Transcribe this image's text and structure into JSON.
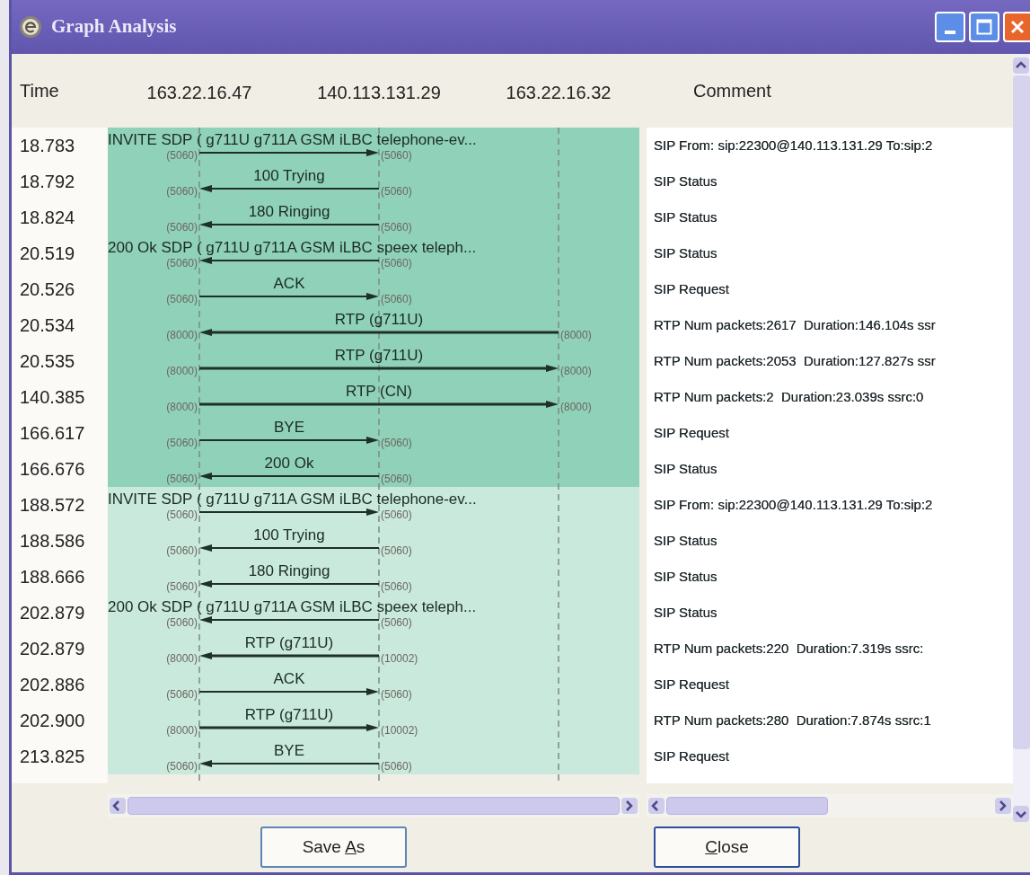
{
  "window": {
    "title": "Graph Analysis"
  },
  "header": {
    "time": "Time",
    "nodes": [
      "163.22.16.47",
      "140.113.131.29",
      "163.22.16.32"
    ],
    "comment": "Comment"
  },
  "calls": [
    {
      "color": "#8fd1b9",
      "rows": [
        {
          "time": "18.783",
          "label": "INVITE SDP ( g711U g711A GSM iLBC telephone-ev...",
          "port_a": "(5060)",
          "port_b": "(5060)",
          "leftward": false,
          "kind": "sip",
          "comment": "SIP From: sip:22300@140.113.131.29 To:sip:2"
        },
        {
          "time": "18.792",
          "label": "100 Trying",
          "port_a": "(5060)",
          "port_b": "(5060)",
          "leftward": true,
          "kind": "sip",
          "comment": "SIP Status"
        },
        {
          "time": "18.824",
          "label": "180 Ringing",
          "port_a": "(5060)",
          "port_b": "(5060)",
          "leftward": true,
          "kind": "sip",
          "comment": "SIP Status"
        },
        {
          "time": "20.519",
          "label": "200 Ok SDP ( g711U g711A GSM iLBC speex teleph...",
          "port_a": "(5060)",
          "port_b": "(5060)",
          "leftward": true,
          "kind": "sip",
          "comment": "SIP Status"
        },
        {
          "time": "20.526",
          "label": "ACK",
          "port_a": "(5060)",
          "port_b": "(5060)",
          "leftward": false,
          "kind": "sip",
          "comment": "SIP Request"
        },
        {
          "time": "20.534",
          "label": "RTP (g711U)",
          "port_a": "(8000)",
          "port_c": "(8000)",
          "leftward": true,
          "kind": "rtp",
          "comment": "RTP Num packets:2617  Duration:146.104s ssr"
        },
        {
          "time": "20.535",
          "label": "RTP (g711U)",
          "port_a": "(8000)",
          "port_c": "(8000)",
          "leftward": false,
          "kind": "rtp",
          "comment": "RTP Num packets:2053  Duration:127.827s ssr"
        },
        {
          "time": "140.385",
          "label": "RTP (CN)",
          "port_a": "(8000)",
          "port_c": "(8000)",
          "leftward": false,
          "kind": "rtp",
          "comment": "RTP Num packets:2  Duration:23.039s ssrc:0"
        },
        {
          "time": "166.617",
          "label": "BYE",
          "port_a": "(5060)",
          "port_b": "(5060)",
          "leftward": false,
          "kind": "sip",
          "comment": "SIP Request"
        },
        {
          "time": "166.676",
          "label": "200 Ok",
          "port_a": "(5060)",
          "port_b": "(5060)",
          "leftward": true,
          "kind": "sip",
          "comment": "SIP Status"
        }
      ]
    },
    {
      "color": "#c8e9dc",
      "rows": [
        {
          "time": "188.572",
          "label": "INVITE SDP ( g711U g711A GSM iLBC telephone-ev...",
          "port_a": "(5060)",
          "port_b": "(5060)",
          "leftward": false,
          "kind": "sip",
          "comment": "SIP From: sip:22300@140.113.131.29 To:sip:2"
        },
        {
          "time": "188.586",
          "label": "100 Trying",
          "port_a": "(5060)",
          "port_b": "(5060)",
          "leftward": true,
          "kind": "sip",
          "comment": "SIP Status"
        },
        {
          "time": "188.666",
          "label": "180 Ringing",
          "port_a": "(5060)",
          "port_b": "(5060)",
          "leftward": true,
          "kind": "sip",
          "comment": "SIP Status"
        },
        {
          "time": "202.879",
          "label": "200 Ok SDP ( g711U g711A GSM iLBC speex teleph...",
          "port_a": "(5060)",
          "port_b": "(5060)",
          "leftward": true,
          "kind": "sip",
          "comment": "SIP Status"
        },
        {
          "time": "202.879",
          "label": "RTP (g711U)",
          "port_a": "(8000)",
          "port_b": "(10002)",
          "leftward": true,
          "kind": "rtp",
          "comment": "RTP Num packets:220  Duration:7.319s ssrc:"
        },
        {
          "time": "202.886",
          "label": "ACK",
          "port_a": "(5060)",
          "port_b": "(5060)",
          "leftward": false,
          "kind": "sip",
          "comment": "SIP Request"
        },
        {
          "time": "202.900",
          "label": "RTP (g711U)",
          "port_a": "(8000)",
          "port_b": "(10002)",
          "leftward": false,
          "kind": "rtp",
          "comment": "RTP Num packets:280  Duration:7.874s ssrc:1"
        },
        {
          "time": "213.825",
          "label": "BYE",
          "port_a": "(5060)",
          "port_b": "(5060)",
          "leftward": true,
          "kind": "sip",
          "comment": "SIP Request"
        }
      ]
    }
  ],
  "buttons": [
    {
      "before": "Save ",
      "mnemonic": "A",
      "after": "s",
      "focused": false
    },
    {
      "mnemonic": "C",
      "after": "lose",
      "focused": true
    }
  ]
}
